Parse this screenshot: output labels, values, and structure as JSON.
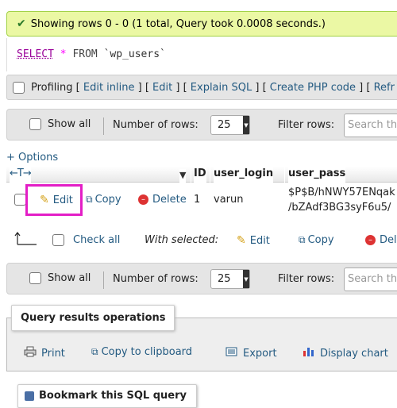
{
  "success": {
    "icon": "check-icon",
    "text": "Showing rows 0 - 0 (1 total, Query took 0.0008 seconds.)"
  },
  "sql": {
    "select": "SELECT",
    "star": "*",
    "from": "FROM",
    "table": "`wp_users`"
  },
  "profiling": {
    "label": "Profiling",
    "links": [
      "Edit inline",
      "Edit",
      "Explain SQL",
      "Create PHP code",
      "Refr"
    ]
  },
  "nav": {
    "show_all": "Show all",
    "rows_label": "Number of rows:",
    "rows_value": "25",
    "filter_label": "Filter rows:",
    "filter_placeholder": "Search th"
  },
  "options": "+ Options",
  "table": {
    "arrows": "←T→",
    "headers": [
      "ID",
      "user_login",
      "user_pass"
    ],
    "row": {
      "edit": "Edit",
      "copy": "Copy",
      "delete": "Delete",
      "id": "1",
      "user_login": "varun",
      "user_pass_line1": "$P$B/hNWY57ENqak",
      "user_pass_line2": "/bZAdf3BG3syF6u5/"
    }
  },
  "bulk": {
    "check_all": "Check all",
    "with_selected": "With selected:",
    "edit": "Edit",
    "copy": "Copy",
    "delete": "Del"
  },
  "ops": {
    "title": "Query results operations",
    "print": "Print",
    "clipboard": "Copy to clipboard",
    "export": "Export",
    "chart": "Display chart"
  },
  "bookmark": {
    "title": "Bookmark this SQL query"
  }
}
